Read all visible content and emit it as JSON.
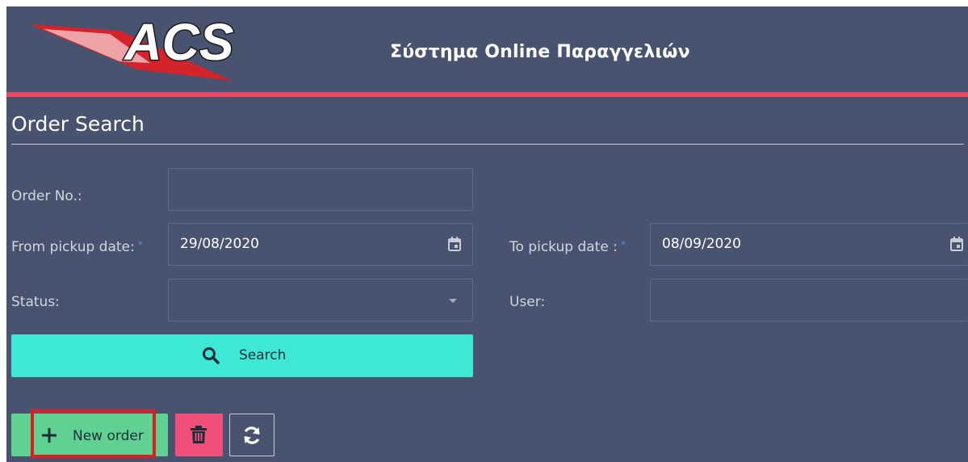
{
  "header": {
    "logo_text": "ACS",
    "app_title": "Σύστημα Online Παραγγελιών"
  },
  "section": {
    "title": "Order Search"
  },
  "form": {
    "order_no": {
      "label": "Order No.:",
      "value": ""
    },
    "from_pickup_date": {
      "label": "From pickup date:",
      "required_marker": "*",
      "value": "29/08/2020",
      "icon": "calendar-icon"
    },
    "to_pickup_date": {
      "label": "To pickup date :",
      "required_marker": "*",
      "value": "08/09/2020",
      "icon": "calendar-icon"
    },
    "status": {
      "label": "Status:",
      "value": "",
      "icon": "chevron-down-icon"
    },
    "user": {
      "label": "User:",
      "value": ""
    }
  },
  "search_button": {
    "label": "Search",
    "icon": "search-icon"
  },
  "actions": {
    "new_order_label": "New order",
    "new_order_icon": "plus-icon",
    "delete_icon": "trash-icon",
    "refresh_icon": "refresh-icon"
  },
  "colors": {
    "background": "#48536f",
    "accent_bar": "#e8476a",
    "search_button": "#3de8d4",
    "new_order_button": "#5fd192",
    "delete_button": "#ef4f78",
    "highlight_outline": "#e11b22"
  }
}
